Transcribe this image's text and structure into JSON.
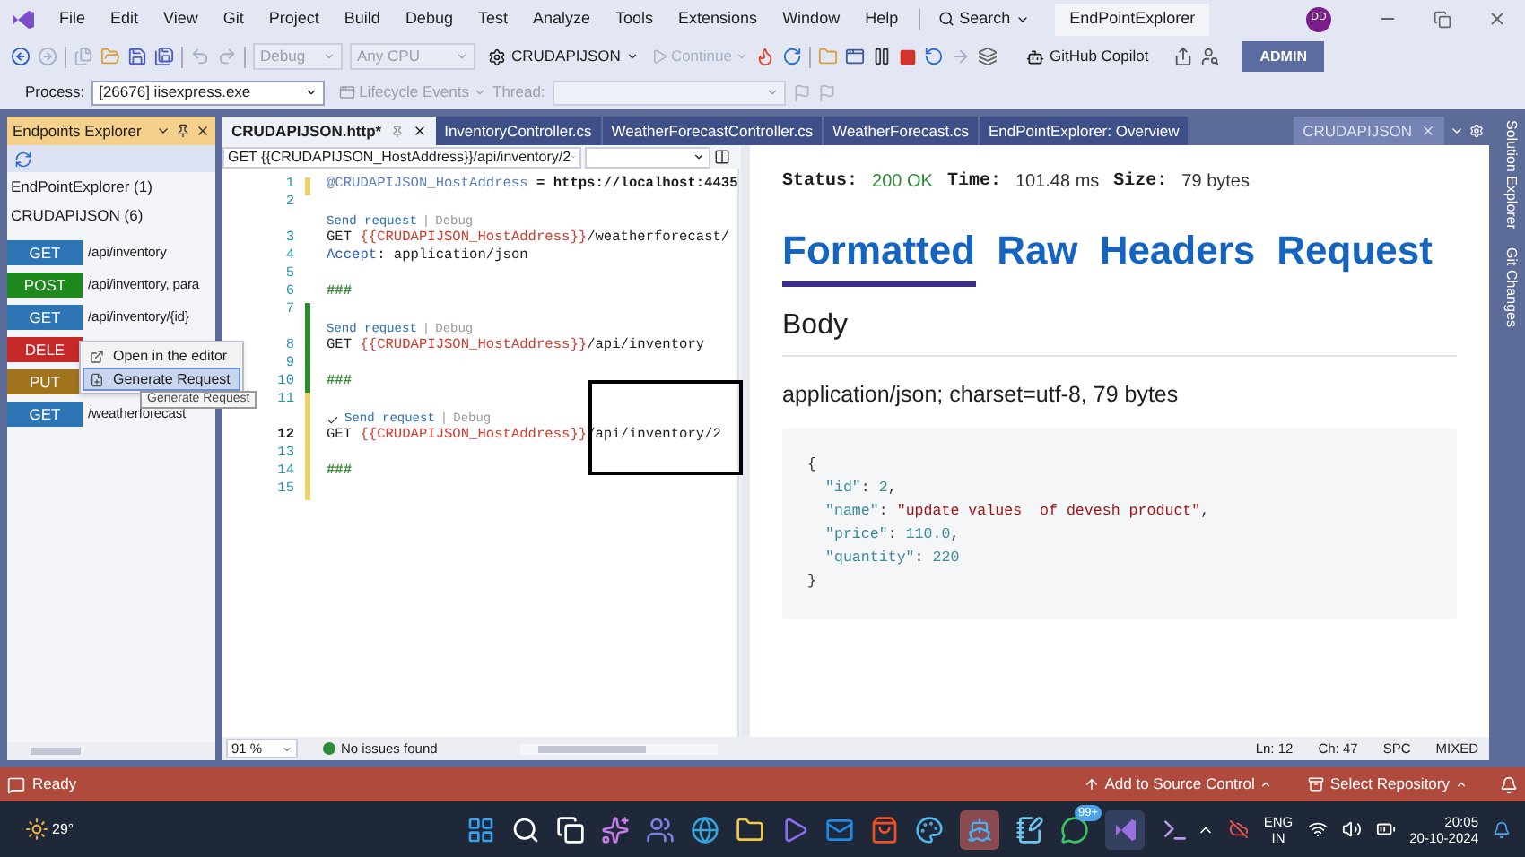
{
  "menu_bar": {
    "items": [
      "File",
      "Edit",
      "View",
      "Git",
      "Project",
      "Build",
      "Debug",
      "Test",
      "Analyze",
      "Tools",
      "Extensions",
      "Window",
      "Help"
    ],
    "search": "Search",
    "solution_title": "EndPointExplorer",
    "avatar": "DD"
  },
  "toolbar": {
    "configuration": {
      "value": "Debug",
      "disabled": true
    },
    "platform": {
      "value": "Any CPU",
      "disabled": true
    },
    "startup_project": "CRUDAPIJSON",
    "continue": {
      "label": "Continue",
      "disabled": true
    },
    "copilot": "GitHub Copilot",
    "admin": "ADMIN"
  },
  "debug_location": {
    "process_label": "Process:",
    "process": "[26676] iisexpress.exe",
    "lifecycle_events": {
      "label": "Lifecycle Events",
      "disabled": true
    },
    "thread_label": "Thread:"
  },
  "endpoints_explorer": {
    "title": "Endpoints Explorer",
    "groups": [
      "EndPointExplorer (1)",
      "CRUDAPIJSON (6)"
    ],
    "endpoints": [
      {
        "method": "GET",
        "path": "/api/inventory",
        "color": "#2e75b6"
      },
      {
        "method": "POST",
        "path": "/api/inventory, para",
        "color": "#1e8a1e"
      },
      {
        "method": "GET",
        "path": "/api/inventory/{id}",
        "color": "#2e75b6"
      },
      {
        "method": "DELE",
        "color": "#c62828"
      },
      {
        "method": "PUT",
        "color": "#a0731c"
      },
      {
        "method": "GET",
        "path": "/weatherforecast",
        "color": "#2e75b6"
      }
    ]
  },
  "context_menu": {
    "items": [
      {
        "label": "Open in the editor",
        "selected": false
      },
      {
        "label": "Generate Request",
        "selected": true
      }
    ],
    "tooltip": "Generate Request"
  },
  "tabs": [
    {
      "label": "CRUDAPIJSON.http*",
      "selected": true,
      "kind": "document"
    },
    {
      "label": "InventoryController.cs",
      "selected": false,
      "kind": "document"
    },
    {
      "label": "WeatherForecastController.cs",
      "selected": false,
      "kind": "document"
    },
    {
      "label": "WeatherForecast.cs",
      "selected": false,
      "kind": "document"
    },
    {
      "label": "EndPointExplorer: Overview",
      "selected": false,
      "kind": "document"
    },
    {
      "label": "CRUDAPIJSON",
      "selected": false,
      "kind": "preview"
    }
  ],
  "editor": {
    "request_selector": "GET {{CRUDAPIJSON_HostAddress}}/api/inventory/2",
    "lines": [
      {
        "kind": "code",
        "num": "1",
        "saved": false,
        "parts": [
          {
            "t": "@CRUDAPIJSON_HostAddress",
            "kind": "var"
          },
          {
            "t": " = https://localhost:4435",
            "kind": "bold"
          }
        ]
      },
      {
        "kind": "code",
        "num": "2"
      },
      {
        "kind": "lens",
        "sent": false,
        "link": "Send request",
        "separator": "|",
        "debug": "Debug"
      },
      {
        "kind": "code",
        "num": "3",
        "parts": [
          {
            "t": "GET ",
            "kind": "plain"
          },
          {
            "t": "{{CRUDAPIJSON_HostAddress}}",
            "kind": "ref"
          },
          {
            "t": "/weatherforecast/",
            "kind": "plain"
          }
        ]
      },
      {
        "kind": "code",
        "num": "4",
        "parts": [
          {
            "t": "Accept",
            "kind": "header"
          },
          {
            "t": ": application/json",
            "kind": "plain"
          }
        ]
      },
      {
        "kind": "code",
        "num": "5"
      },
      {
        "kind": "code",
        "num": "6",
        "parts": [
          {
            "t": "###",
            "kind": "sep"
          }
        ]
      },
      {
        "kind": "code",
        "num": "7",
        "saved": true
      },
      {
        "kind": "lens",
        "sent": false,
        "saved": true,
        "link": "Send request",
        "separator": "|",
        "debug": "Debug"
      },
      {
        "kind": "code",
        "num": "8",
        "saved": true,
        "parts": [
          {
            "t": "GET ",
            "kind": "plain"
          },
          {
            "t": "{{CRUDAPIJSON_HostAddress}}",
            "kind": "ref"
          },
          {
            "t": "/api/inventory",
            "kind": "plain"
          }
        ]
      },
      {
        "kind": "code",
        "num": "9",
        "saved": true
      },
      {
        "kind": "code",
        "num": "10",
        "saved": true,
        "parts": [
          {
            "t": "###",
            "kind": "sep"
          }
        ]
      },
      {
        "kind": "code",
        "num": "11",
        "saved": false
      },
      {
        "kind": "lens",
        "sent": true,
        "saved": false,
        "link": "Send request",
        "separator": "|",
        "debug": "Debug"
      },
      {
        "kind": "code",
        "num": "12",
        "current": true,
        "saved": false,
        "parts": [
          {
            "t": "GET ",
            "kind": "plain"
          },
          {
            "t": "{{CRUDAPIJSON_HostAddress}}",
            "kind": "ref"
          },
          {
            "t": "/api/inventory/2",
            "kind": "plain"
          }
        ]
      },
      {
        "kind": "code",
        "num": "13",
        "saved": false
      },
      {
        "kind": "code",
        "num": "14",
        "saved": false,
        "parts": [
          {
            "t": "###",
            "kind": "sep"
          }
        ]
      },
      {
        "kind": "code",
        "num": "15",
        "saved": false
      }
    ],
    "zoom": "91 %",
    "issues": "No issues found",
    "line": "Ln: 12",
    "char": "Ch: 47",
    "spacing": "SPC",
    "line_endings": "MIXED"
  },
  "response": {
    "status": [
      {
        "label": "Status:",
        "value": "200 OK",
        "kind": "success"
      },
      {
        "label": "Time:",
        "value": "101.48 ms",
        "kind": "plain"
      },
      {
        "label": "Size:",
        "value": "79 bytes",
        "kind": "plain"
      }
    ],
    "tabs": [
      {
        "label": "Formatted",
        "selected": true
      },
      {
        "label": "Raw",
        "selected": false
      },
      {
        "label": "Headers",
        "selected": false
      },
      {
        "label": "Request",
        "selected": false
      }
    ],
    "section": "Body",
    "content_type": "application/json; charset=utf-8, 79 bytes",
    "body": [
      {
        "nested": false,
        "parts": [
          {
            "t": "{",
            "kind": "punct"
          }
        ]
      },
      {
        "nested": true,
        "parts": [
          {
            "t": "\"id\"",
            "kind": "key"
          },
          {
            "t": ": ",
            "kind": "punct"
          },
          {
            "t": "2",
            "kind": "number"
          },
          {
            "t": ",",
            "kind": "punct"
          }
        ]
      },
      {
        "nested": true,
        "parts": [
          {
            "t": "\"name\"",
            "kind": "key"
          },
          {
            "t": ": ",
            "kind": "punct"
          },
          {
            "t": "\"update values  of devesh product\"",
            "kind": "string"
          },
          {
            "t": ",",
            "kind": "punct"
          }
        ]
      },
      {
        "nested": true,
        "parts": [
          {
            "t": "\"price\"",
            "kind": "key"
          },
          {
            "t": ": ",
            "kind": "punct"
          },
          {
            "t": "110.0",
            "kind": "number"
          },
          {
            "t": ",",
            "kind": "punct"
          }
        ]
      },
      {
        "nested": true,
        "parts": [
          {
            "t": "\"quantity\"",
            "kind": "key"
          },
          {
            "t": ": ",
            "kind": "punct"
          },
          {
            "t": "220",
            "kind": "number"
          }
        ]
      },
      {
        "nested": false,
        "parts": [
          {
            "t": "}",
            "kind": "punct"
          }
        ]
      }
    ]
  },
  "side_tabs": [
    "Solution Explorer",
    "Git Changes"
  ],
  "status_bar": {
    "message": "Ready",
    "source_control": "Add to Source Control",
    "repository": "Select Repository"
  },
  "taskbar": {
    "weather": "29°",
    "badge": "99+",
    "language": "ENG",
    "region": "IN",
    "time": "20:05",
    "date": "20-10-2024"
  }
}
